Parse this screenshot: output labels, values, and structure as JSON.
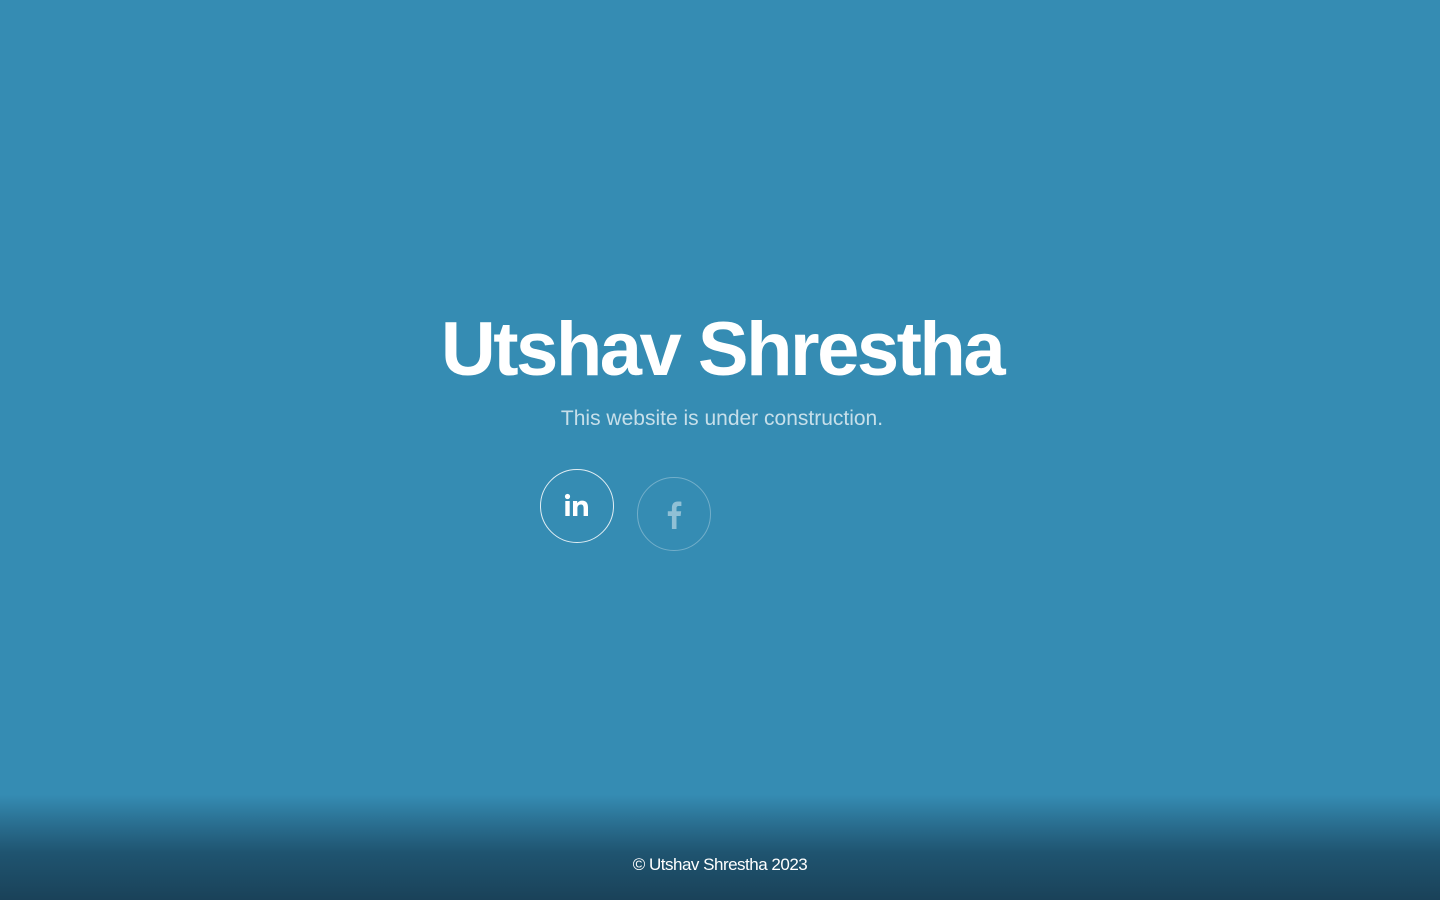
{
  "hero": {
    "title": "Utshav Shrestha",
    "subtitle": "This website is under construction."
  },
  "social": [
    {
      "name": "LinkedIn",
      "icon": "linkedin-icon"
    },
    {
      "name": "Facebook",
      "icon": "facebook-icon"
    }
  ],
  "footer": {
    "copyright": "© Utshav Shrestha 2023"
  },
  "colors": {
    "background": "#358cb3",
    "footer_dark": "#1a4259",
    "text": "#ffffff"
  }
}
